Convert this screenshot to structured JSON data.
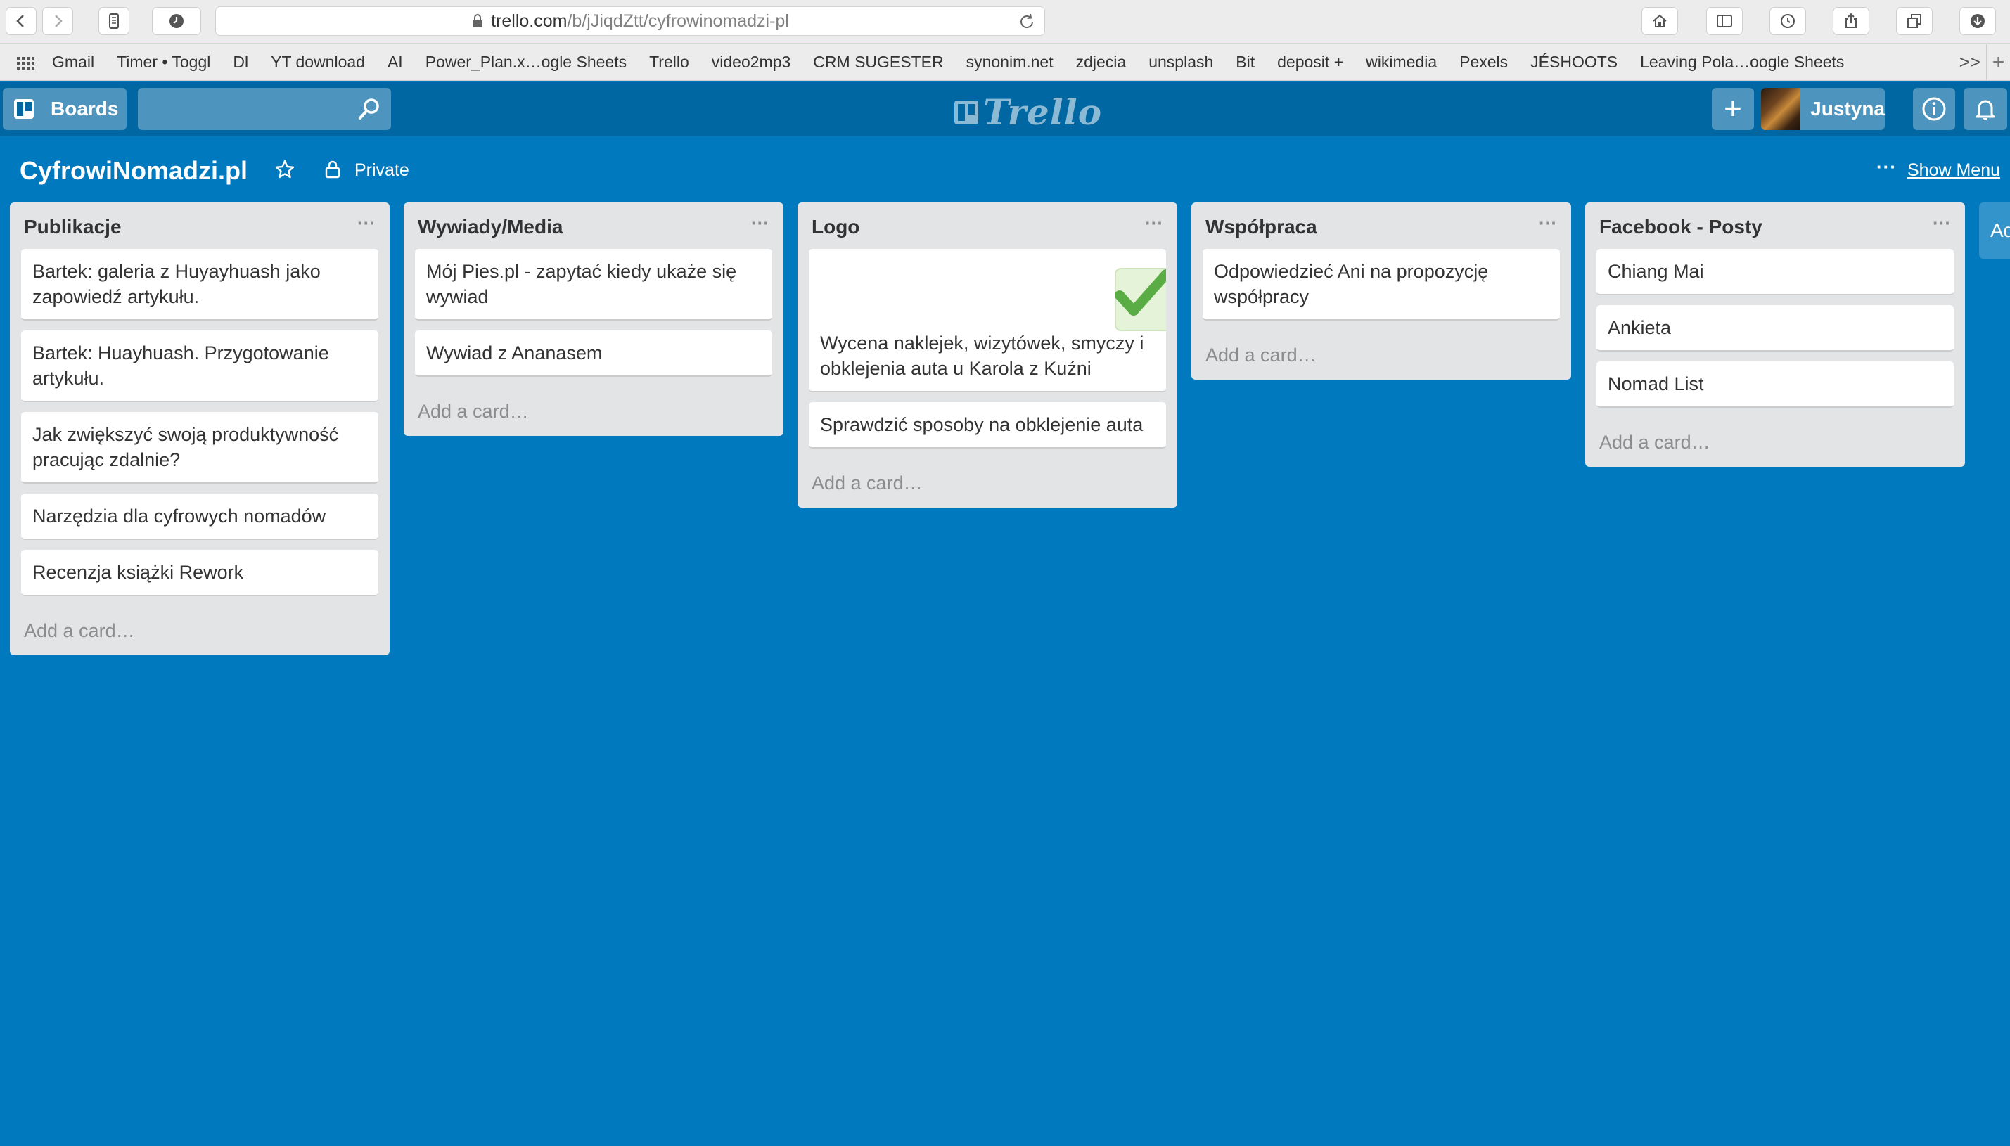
{
  "browser": {
    "url_prefix": "trello.com",
    "url_path": "/b/jJiqdZtt/cyfrowinomadzi-pl",
    "bookmarks": [
      "Gmail",
      "Timer • Toggl",
      "Dl",
      "YT download",
      "AI",
      "Power_Plan.x…ogle Sheets",
      "Trello",
      "video2mp3",
      "CRM SUGESTER",
      "synonim.net",
      "zdjecia",
      "unsplash",
      "Bit",
      "deposit +",
      "wikimedia",
      "Pexels",
      "JÉSHOOTS",
      "Leaving Pola…oogle Sheets"
    ],
    "more_label": ">>",
    "new_tab_label": "+"
  },
  "header": {
    "boards_label": "Boards",
    "search_placeholder": "",
    "logo_text": "Trello",
    "add_label": "+",
    "user_name": "Justyna"
  },
  "board": {
    "title": "CyfrowiNomadzi.pl",
    "visibility": "Private",
    "menu_dots": "···",
    "show_menu_label": "Show Menu",
    "add_list_stub": "Ad"
  },
  "lists": [
    {
      "title": "Publikacje",
      "menu": "···",
      "cards": [
        "Bartek: galeria z Huyayhuash jako zapowiedź artykułu.",
        "Bartek: Huayhuash. Przygotowanie artykułu.",
        "Jak zwiększyć swoją produktywność pracując zdalnie?",
        "Narzędzia dla cyfrowych nomadów",
        "Recenzja książki Rework"
      ],
      "add_card": "Add a card…"
    },
    {
      "title": "Wywiady/Media",
      "menu": "···",
      "cards": [
        "Mój Pies.pl - zapytać kiedy ukaże się wywiad",
        "Wywiad z Ananasem"
      ],
      "add_card": "Add a card…"
    },
    {
      "title": "Logo",
      "menu": "···",
      "cover_card": "Wycena naklejek, wizytówek, smyczy i obklejenia auta u Karola z Kuźni",
      "cards": [
        "Sprawdzić sposoby na obklejenie auta"
      ],
      "add_card": "Add a card…"
    },
    {
      "title": "Współpraca",
      "menu": "···",
      "cards": [
        "Odpowiedzieć Ani na propozycję współpracy"
      ],
      "add_card": "Add a card…"
    },
    {
      "title": "Facebook - Posty",
      "menu": "···",
      "cards": [
        "Chiang Mai",
        "Ankieta",
        "Nomad List"
      ],
      "add_card": "Add a card…"
    }
  ],
  "colors": {
    "board_bg": "#0079bf",
    "header_bg": "#0067a3",
    "list_bg": "#e2e4e6",
    "check_green": "#5aac44"
  }
}
